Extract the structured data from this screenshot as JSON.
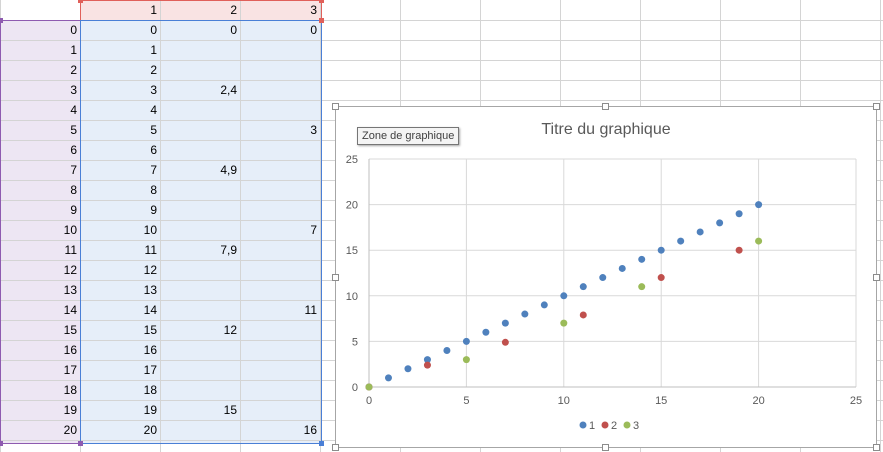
{
  "sheet": {
    "header_row": [
      "",
      "1",
      "2",
      "3"
    ],
    "rows": [
      [
        "0",
        "0",
        "0",
        "0"
      ],
      [
        "1",
        "1",
        "",
        ""
      ],
      [
        "2",
        "2",
        "",
        ""
      ],
      [
        "3",
        "3",
        "2,4",
        ""
      ],
      [
        "4",
        "4",
        "",
        ""
      ],
      [
        "5",
        "5",
        "",
        "3"
      ],
      [
        "6",
        "6",
        "",
        ""
      ],
      [
        "7",
        "7",
        "4,9",
        ""
      ],
      [
        "8",
        "8",
        "",
        ""
      ],
      [
        "9",
        "9",
        "",
        ""
      ],
      [
        "10",
        "10",
        "",
        "7"
      ],
      [
        "11",
        "11",
        "7,9",
        ""
      ],
      [
        "12",
        "12",
        "",
        ""
      ],
      [
        "13",
        "13",
        "",
        ""
      ],
      [
        "14",
        "14",
        "",
        "11"
      ],
      [
        "15",
        "15",
        "12",
        ""
      ],
      [
        "16",
        "16",
        "",
        ""
      ],
      [
        "17",
        "17",
        "",
        ""
      ],
      [
        "18",
        "18",
        "",
        ""
      ],
      [
        "19",
        "19",
        "15",
        ""
      ],
      [
        "20",
        "20",
        "",
        "16"
      ]
    ]
  },
  "tooltip": "Zone de graphique",
  "chart_data": {
    "type": "scatter",
    "title": "Titre du graphique",
    "xlim": [
      0,
      25
    ],
    "ylim": [
      0,
      25
    ],
    "xticks": [
      "0",
      "5",
      "10",
      "15",
      "20",
      "25"
    ],
    "yticks": [
      "0",
      "5",
      "10",
      "15",
      "20",
      "25"
    ],
    "grid": true,
    "legend_position": "bottom",
    "series": [
      {
        "name": "1",
        "color": "#4f81bd",
        "points": [
          [
            0,
            0
          ],
          [
            1,
            1
          ],
          [
            2,
            2
          ],
          [
            3,
            3
          ],
          [
            4,
            4
          ],
          [
            5,
            5
          ],
          [
            6,
            6
          ],
          [
            7,
            7
          ],
          [
            8,
            8
          ],
          [
            9,
            9
          ],
          [
            10,
            10
          ],
          [
            11,
            11
          ],
          [
            12,
            12
          ],
          [
            13,
            13
          ],
          [
            14,
            14
          ],
          [
            15,
            15
          ],
          [
            16,
            16
          ],
          [
            17,
            17
          ],
          [
            18,
            18
          ],
          [
            19,
            19
          ],
          [
            20,
            20
          ]
        ]
      },
      {
        "name": "2",
        "color": "#c0504d",
        "points": [
          [
            0,
            0
          ],
          [
            3,
            2.4
          ],
          [
            7,
            4.9
          ],
          [
            11,
            7.9
          ],
          [
            15,
            12
          ],
          [
            19,
            15
          ]
        ]
      },
      {
        "name": "3",
        "color": "#9bbb59",
        "points": [
          [
            0,
            0
          ],
          [
            5,
            3
          ],
          [
            10,
            7
          ],
          [
            14,
            11
          ],
          [
            20,
            16
          ]
        ]
      }
    ]
  }
}
